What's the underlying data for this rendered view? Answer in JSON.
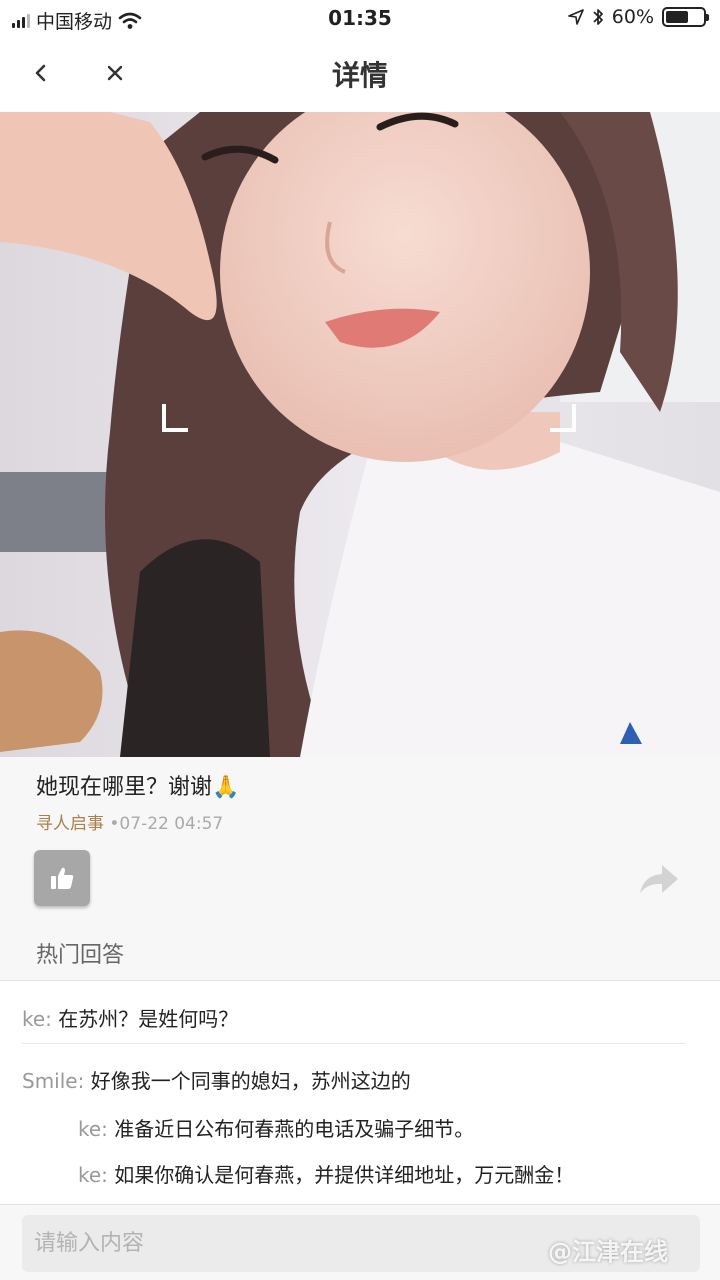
{
  "status_bar": {
    "carrier": "中国移动",
    "time": "01:35",
    "battery": "60%",
    "battery_level": 0.6,
    "icons": [
      "signal-icon",
      "wifi-icon",
      "location-arrow-icon",
      "bluetooth-icon",
      "battery-icon"
    ]
  },
  "nav": {
    "title": "详情",
    "icons": [
      "back-chevron-icon",
      "close-icon"
    ]
  },
  "post": {
    "question": "她现在哪里？谢谢🙏",
    "category": "寻人启事",
    "date": "•07-22 04:57",
    "hot_answers_label": "热门回答",
    "icons": [
      "thumbs-up-icon",
      "share-arrow-icon"
    ]
  },
  "answers": [
    {
      "author": "ke:",
      "text": "在苏州？是姓何吗？"
    },
    {
      "author": "Smile:",
      "text": "好像我一个同事的媳妇，苏州这边的"
    },
    {
      "author": "ke:",
      "text": "准备近日公布何春燕的电话及骗子细节。"
    },
    {
      "author": "ke:",
      "text": "如果你确认是何春燕，并提供详细地址，万元酬金！"
    }
  ],
  "input": {
    "placeholder": "请输入内容"
  },
  "watermark": "@江津在线",
  "colors": {
    "category": "#a9804a",
    "meta_gray": "#aaaaaa",
    "author_gray": "#999999",
    "like_button": "#a7a7a7"
  }
}
